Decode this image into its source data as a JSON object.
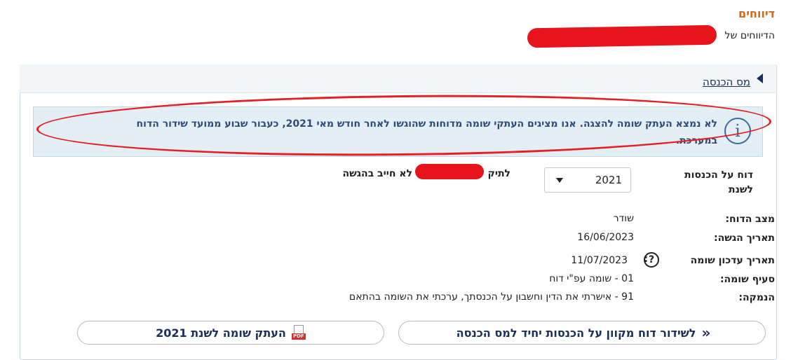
{
  "section": {
    "title": "דיווחים",
    "owner_prefix": "הדיווחים של"
  },
  "panel": {
    "header_link": "מס הכנסה"
  },
  "info": {
    "icon": "info-icon",
    "line1": "לא נמצא העתק שומה להצגה. אנו מציגים העתקי שומה מדוחות שהוגשו לאחר חודש מאי 2021, כעבור שבוע ממועד שידור הדוח",
    "line2": "במערכת."
  },
  "report": {
    "year_label_1": "דוח על הכנסות",
    "year_label_2": "לשנת",
    "year_value": "2021",
    "file_prefix": "לתיק",
    "file_status": "לא חייב בהגשה"
  },
  "details": {
    "status_label": "מצב הדוח:",
    "status_value": "שודר",
    "submit_label": "תאריך הגשה:",
    "submit_value": "16/06/2023",
    "update_label": "תאריך עדכון שומה",
    "update_colon": ":",
    "update_value": "11/07/2023",
    "clause_label": "סעיף שומה:",
    "clause_value": "01 - שומה עפ\"י דוח",
    "reason_label": "הנמקה:",
    "reason_value": "91 - אישרתי את הדין וחשבון על הכנסתך, ערכתי את השומה בהתאם"
  },
  "buttons": {
    "submit_online": "לשידור דוח מקוון על הכנסות יחיד למס הכנסה",
    "copy_label": "העתק שומה לשנת 2021",
    "pdf_tag": "PDF"
  },
  "colors": {
    "accent_orange": "#d4691c",
    "navy": "#1a2e5a",
    "info_bg": "#e4eef5",
    "annotation_red": "#e22026"
  }
}
